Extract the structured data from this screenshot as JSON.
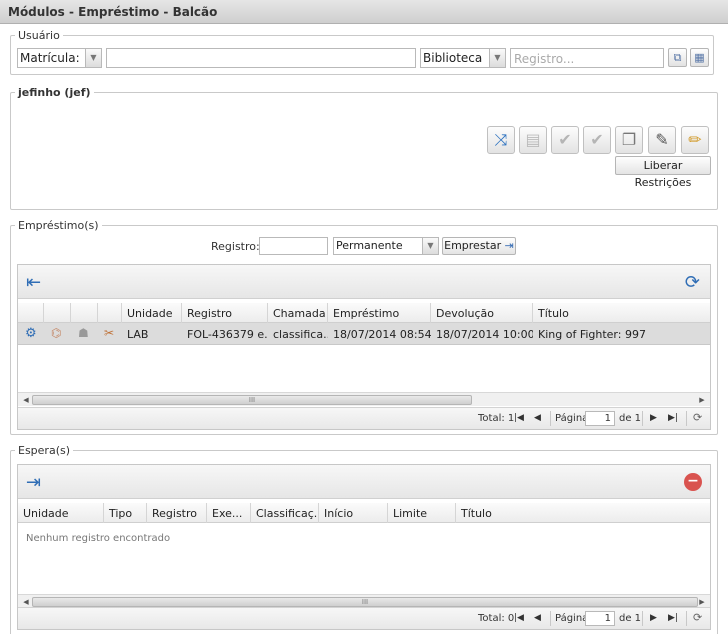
{
  "window": {
    "title": "Módulos - Empréstimo - Balcão"
  },
  "usuario": {
    "legend": "Usuário",
    "tipo": "Matrícula:",
    "biblioteca": "Biblioteca",
    "registro_placeholder": "Registro...",
    "value": ""
  },
  "user_box": {
    "legend": "jefinho (jef)",
    "liberar_label": "Liberar Restrições"
  },
  "emprestimo": {
    "legend": "Empréstimo(s)",
    "registro_label": "Registro:",
    "tipo": "Permanente",
    "emprestar_label": "Emprestar",
    "columns": [
      "Unidade",
      "Registro",
      "Chamada",
      "Empréstimo",
      "Devolução",
      "Título"
    ],
    "rows": [
      {
        "unidade": "LAB",
        "registro": "FOL-436379 e...",
        "chamada": "classifica...",
        "emprestimo": "18/07/2014 08:54",
        "devolucao": "18/07/2014 10:00",
        "titulo": "King of Fighter: 997"
      }
    ],
    "footer": {
      "total": "Total: 1",
      "pagina_label": "Página",
      "page": "1",
      "of": "de 1"
    }
  },
  "espera": {
    "legend": "Espera(s)",
    "columns": [
      "Unidade",
      "Tipo",
      "Registro",
      "Exe...",
      "Classificaç...",
      "Início",
      "Limite",
      "Título"
    ],
    "empty": "Nenhum registro encontrado",
    "footer": {
      "total": "Total: 0",
      "pagina_label": "Página",
      "page": "1",
      "of": "de 1"
    }
  }
}
